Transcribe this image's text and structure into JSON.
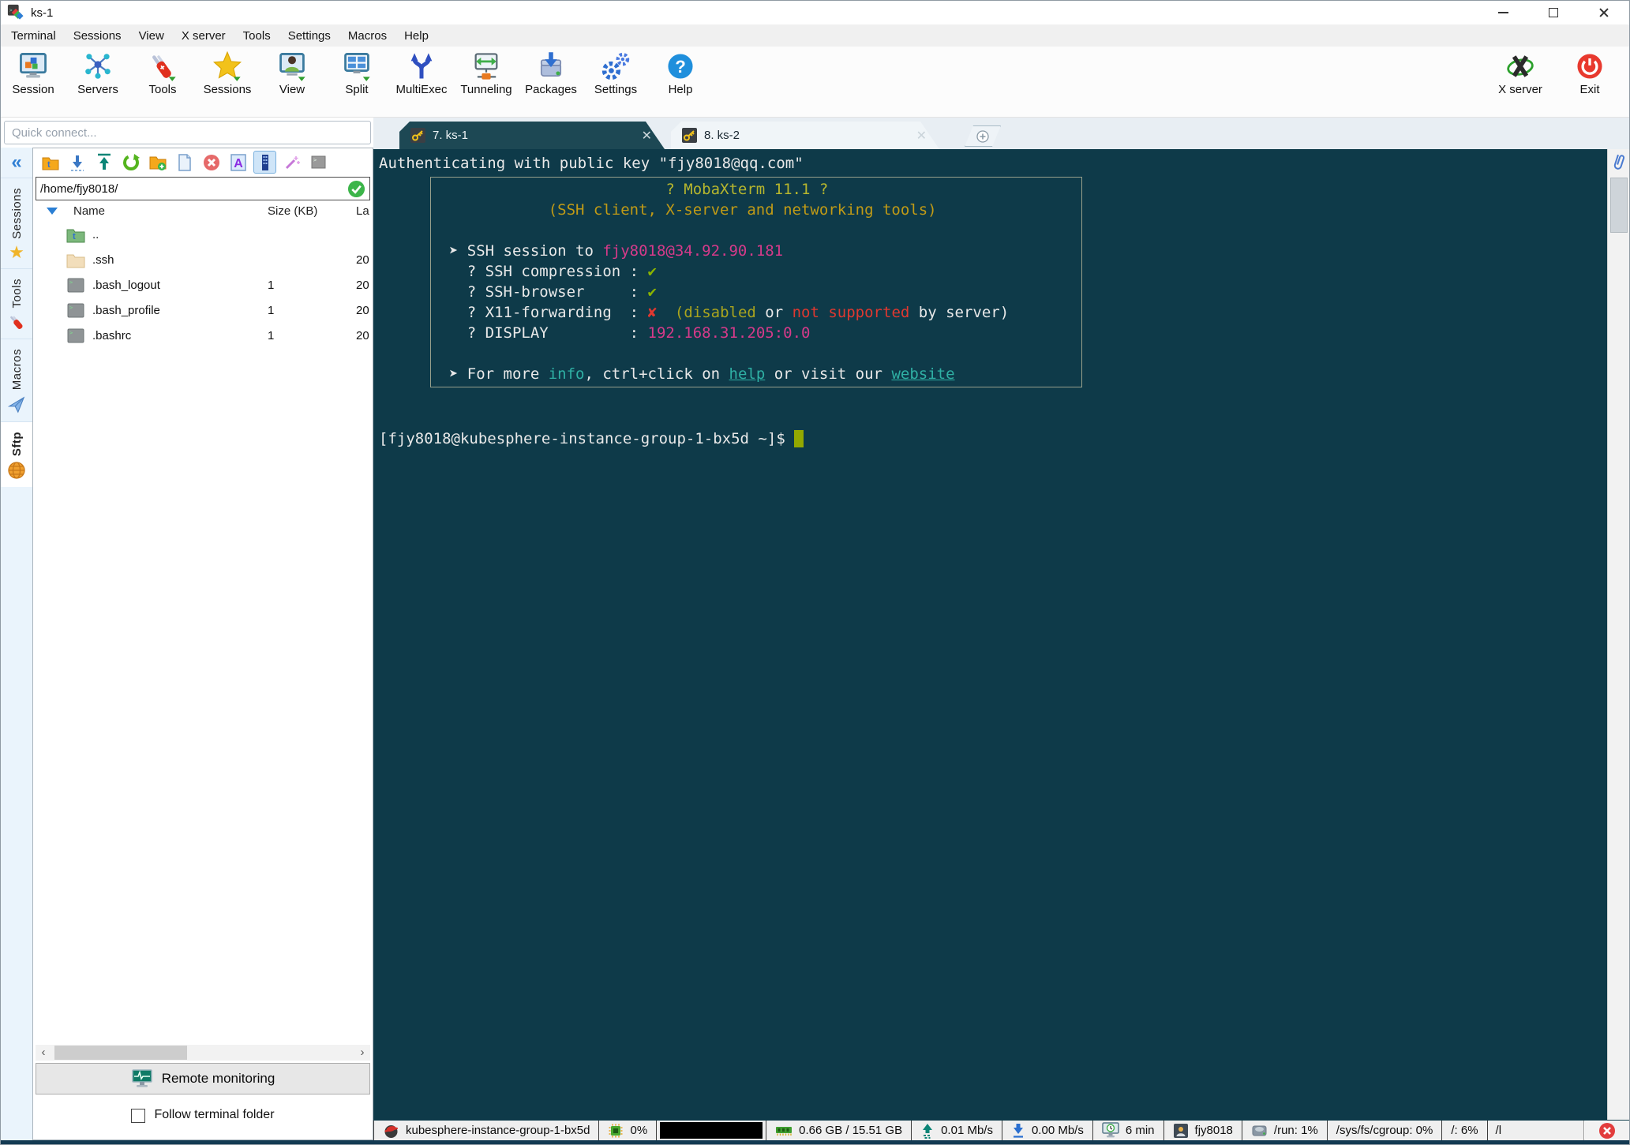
{
  "window": {
    "title": "ks-1"
  },
  "menu": {
    "items": [
      "Terminal",
      "Sessions",
      "View",
      "X server",
      "Tools",
      "Settings",
      "Macros",
      "Help"
    ]
  },
  "toolbar": {
    "items": [
      "Session",
      "Servers",
      "Tools",
      "Sessions",
      "View",
      "Split",
      "MultiExec",
      "Tunneling",
      "Packages",
      "Settings",
      "Help"
    ],
    "right": [
      "X server",
      "Exit"
    ]
  },
  "quick_connect": {
    "placeholder": "Quick connect..."
  },
  "tabs": {
    "items": [
      {
        "label": "7. ks-1",
        "active": true,
        "close_glyph": "✕"
      },
      {
        "label": "8. ks-2",
        "active": false,
        "close_glyph": "✕"
      }
    ]
  },
  "sidebar": {
    "collapse_glyph": "«",
    "tabs": [
      {
        "label": "Sessions",
        "icon": "star-icon"
      },
      {
        "label": "Tools",
        "icon": "swiss-knife-icon"
      },
      {
        "label": "Macros",
        "icon": "paper-plane-icon"
      },
      {
        "label": "Sftp",
        "icon": "globe-icon",
        "active": true
      }
    ]
  },
  "sftp": {
    "toolbar_icons": [
      "home-folder-icon",
      "download-icon",
      "upload-icon",
      "refresh-icon",
      "new-folder-icon",
      "new-file-icon",
      "delete-icon",
      "rename-icon",
      "columns-icon",
      "wand-icon",
      "console-icon"
    ],
    "path": "/home/fjy8018/",
    "columns": [
      "Name",
      "Size (KB)",
      "La"
    ],
    "files": [
      {
        "name": "..",
        "icon": "parent-folder-icon",
        "size": "",
        "modified": ""
      },
      {
        "name": ".ssh",
        "icon": "folder-icon",
        "size": "",
        "modified": "20"
      },
      {
        "name": ".bash_logout",
        "icon": "script-file-icon",
        "size": "1",
        "modified": "20"
      },
      {
        "name": ".bash_profile",
        "icon": "script-file-icon",
        "size": "1",
        "modified": "20"
      },
      {
        "name": ".bashrc",
        "icon": "script-file-icon",
        "size": "1",
        "modified": "20"
      }
    ],
    "scroll_left_glyph": "‹",
    "scroll_right_glyph": "›",
    "remote_monitoring_label": "Remote monitoring",
    "follow_checkbox_label": "Follow terminal folder"
  },
  "terminal": {
    "top": [
      [
        [
          "w",
          "Authenticating with public key \"fjy8018@qq.com\""
        ]
      ]
    ],
    "banner": [
      [
        [
          "y",
          "                          ? MobaXterm 11.1 ?"
        ]
      ],
      [
        [
          "g",
          "             (SSH client, X-server and networking tools)"
        ]
      ],
      [],
      [
        [
          "w",
          "  ➤ SSH session to "
        ],
        [
          "m",
          "fjy8018@34.92.90.181"
        ]
      ],
      [
        [
          "w",
          "    ? SSH compression : "
        ],
        [
          "gr",
          "✔"
        ]
      ],
      [
        [
          "w",
          "    ? SSH-browser     : "
        ],
        [
          "gr",
          "✔"
        ]
      ],
      [
        [
          "w",
          "    ? X11-forwarding  : "
        ],
        [
          "r",
          "✘"
        ],
        [
          "w",
          "  "
        ],
        [
          "o",
          "(disabled"
        ],
        [
          "w",
          " or "
        ],
        [
          "r",
          "not supported"
        ],
        [
          "w",
          " by server)"
        ]
      ],
      [
        [
          "w",
          "    ? DISPLAY         : "
        ],
        [
          "m",
          "192.168.31.205:0.0"
        ]
      ],
      [],
      [
        [
          "w",
          "  ➤ For more "
        ],
        [
          "t",
          "info"
        ],
        [
          "w",
          ", ctrl+click on "
        ],
        [
          "tu",
          "help"
        ],
        [
          "w",
          " or visit our "
        ],
        [
          "tu",
          "website"
        ]
      ]
    ],
    "bottom": [
      [],
      [],
      [
        [
          "w",
          "[fjy8018@kubesphere-instance-group-1-bx5d ~]$ "
        ],
        [
          "c",
          " "
        ]
      ]
    ]
  },
  "statusbar": {
    "host": "kubesphere-instance-group-1-bx5d",
    "cpu": "0%",
    "ram": "0.66 GB / 15.51 GB",
    "upload": "0.01 Mb/s",
    "download": "0.00 Mb/s",
    "uptime": "6 min",
    "user": "fjy8018",
    "disk_run": "/run: 1%",
    "disk_cgroup": "/sys/fs/cgroup: 0%",
    "disk_root": "/: 6%",
    "disk_truncated": "/l"
  },
  "colors": {
    "terminal_bg": "#0e3a49",
    "tab_active_bg": "#1d4854",
    "banner_title_yellow": "#b6b62e",
    "banner_gold": "#c09a16",
    "magenta": "#d63a8a",
    "check_green": "#8ab300",
    "cross_red": "#e03830",
    "link_teal": "#2fb0a4",
    "cursor_olive": "#93a800",
    "exit_red": "#e8392e",
    "help_blue": "#1f8fdc"
  }
}
